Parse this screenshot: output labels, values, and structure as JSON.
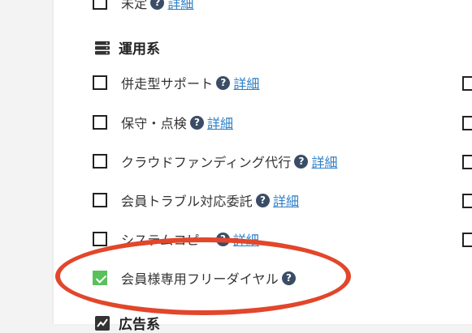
{
  "top_item": {
    "label": "未定",
    "link": "詳細"
  },
  "section_ops": {
    "title": "運用系",
    "items": [
      {
        "label": "併走型サポート",
        "link": "詳細",
        "checked": false
      },
      {
        "label": "保守・点検",
        "link": "詳細",
        "checked": false
      },
      {
        "label": "クラウドファンディング代行",
        "link": "詳細",
        "checked": false
      },
      {
        "label": "会員トラブル対応委託",
        "link": "詳細",
        "checked": false
      },
      {
        "label": "システムコピー",
        "link": "詳細",
        "checked": false
      },
      {
        "label": "会員様専用フリーダイヤル",
        "link": "",
        "checked": true
      }
    ]
  },
  "section_ads": {
    "title": "広告系"
  },
  "help_glyph": "?",
  "colors": {
    "link": "#2d7fc6",
    "check": "#59c15c",
    "highlight": "#e2462b",
    "help_icon": "#3b4d66"
  }
}
